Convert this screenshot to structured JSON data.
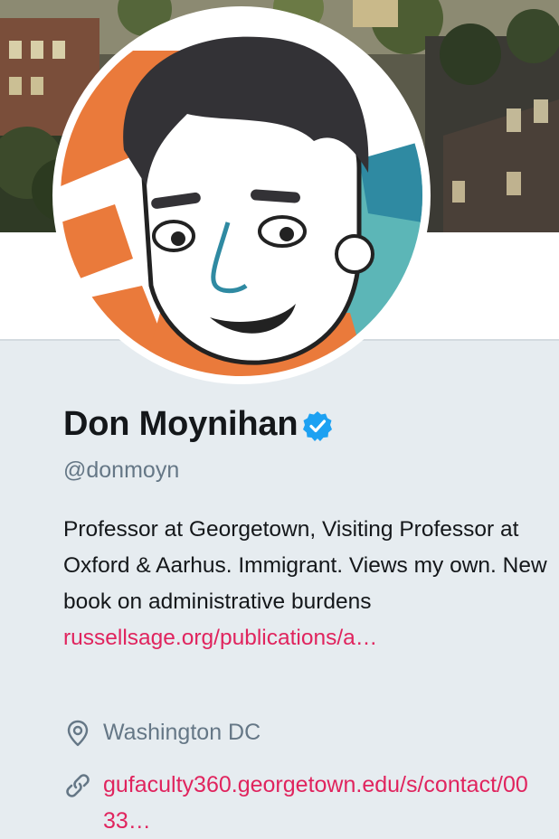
{
  "profile": {
    "name": "Don Moynihan",
    "handle": "@donmoyn",
    "bio_text": "Professor at Georgetown, Visiting Professor at Oxford & Aarhus. Immigrant. Views my own. New book on administrative burdens ",
    "bio_link": "russellsage.org/publications/a…",
    "location": "Washington DC",
    "website": "gufaculty360.georgetown.edu/s/contact/0033…"
  },
  "icons": {
    "verified": "verified-badge-icon",
    "location": "location-pin-icon",
    "website": "link-icon"
  },
  "colors": {
    "background": "#e6ecf0",
    "link": "#e0245e",
    "verified": "#1da1f2",
    "secondary_text": "#657786",
    "primary_text": "#14171a"
  }
}
